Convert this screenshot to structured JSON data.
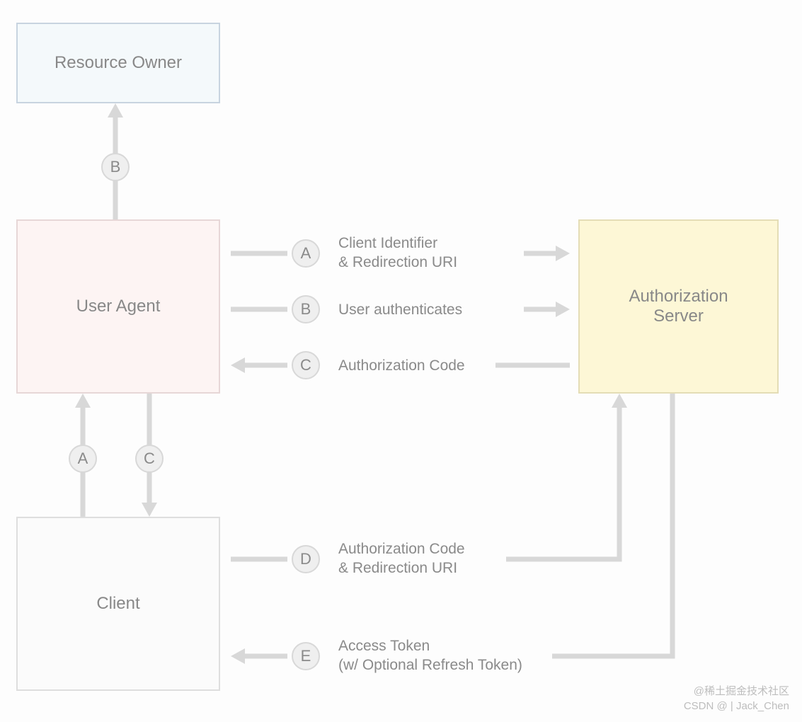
{
  "boxes": {
    "resource_owner": "Resource Owner",
    "user_agent": "User Agent",
    "client": "Client",
    "auth_server_line1": "Authorization",
    "auth_server_line2": "Server"
  },
  "steps": {
    "a": "A",
    "b": "B",
    "c": "C",
    "d": "D",
    "e": "E"
  },
  "labels": {
    "a_line1": "Client Identifier",
    "a_line2": "& Redirection URI",
    "b": "User authenticates",
    "c": "Authorization Code",
    "d_line1": "Authorization Code",
    "d_line2": "& Redirection URI",
    "e_line1": "Access Token",
    "e_line2": "(w/ Optional Refresh Token)"
  },
  "watermark": {
    "line1": "@稀土掘金技术社区",
    "line2": "CSDN @ | Jack_Chen"
  }
}
